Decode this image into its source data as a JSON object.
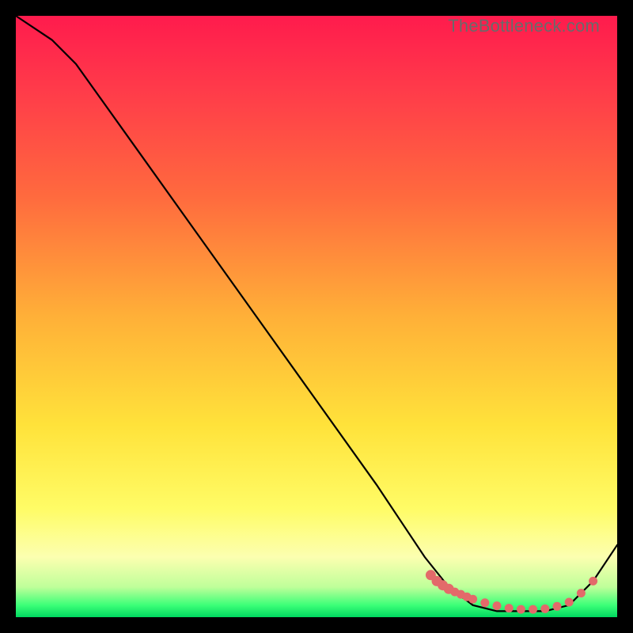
{
  "watermark": "TheBottleneck.com",
  "chart_data": {
    "type": "line",
    "title": "",
    "xlabel": "",
    "ylabel": "",
    "xlim": [
      0,
      100
    ],
    "ylim": [
      0,
      100
    ],
    "series": [
      {
        "name": "bottleneck-curve",
        "x": [
          0,
          6,
          10,
          20,
          30,
          40,
          50,
          60,
          68,
          72,
          76,
          80,
          84,
          88,
          92,
          96,
          100
        ],
        "y": [
          100,
          96,
          92,
          78,
          64,
          50,
          36,
          22,
          10,
          5,
          2,
          1,
          1,
          1,
          2,
          6,
          12
        ]
      }
    ],
    "markers": {
      "name": "flat-region-dots",
      "x": [
        69,
        70,
        71,
        72,
        73,
        74,
        75,
        76,
        78,
        80,
        82,
        84,
        86,
        88,
        90,
        92,
        94,
        96
      ],
      "y": [
        7,
        6,
        5.3,
        4.7,
        4.2,
        3.8,
        3.4,
        3.0,
        2.4,
        1.9,
        1.5,
        1.3,
        1.3,
        1.4,
        1.8,
        2.5,
        4.0,
        6.0
      ]
    },
    "colors": {
      "line": "#000000",
      "marker": "#e36a6a"
    }
  }
}
